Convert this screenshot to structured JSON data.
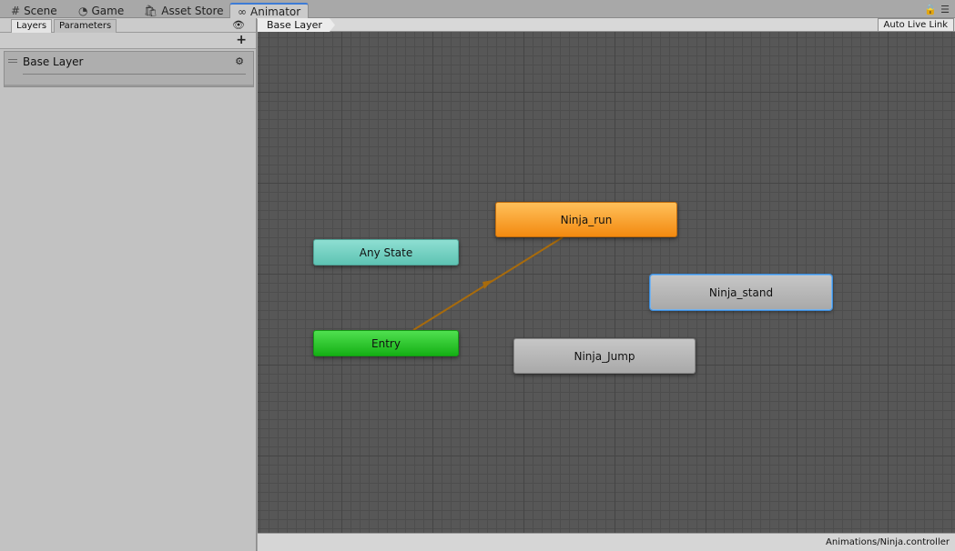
{
  "tabs": [
    {
      "label": "Scene",
      "icon": "hash-icon"
    },
    {
      "label": "Game",
      "icon": "pacman-icon"
    },
    {
      "label": "Asset Store",
      "icon": "store-bag-icon"
    },
    {
      "label": "Animator",
      "icon": "animator-icon"
    }
  ],
  "left_panel": {
    "tabs": [
      "Layers",
      "Parameters"
    ],
    "layer": {
      "name": "Base Layer"
    }
  },
  "graph": {
    "breadcrumb": "Base Layer",
    "auto_live_link": "Auto Live Link",
    "states": {
      "any_state": "Any State",
      "entry": "Entry",
      "ninja_run": "Ninja_run",
      "ninja_stand": "Ninja_stand",
      "ninja_jump": "Ninja_Jump"
    }
  },
  "status": {
    "path": "Animations/Ninja.controller"
  },
  "colors": {
    "accent": "#3d7bd6",
    "default_state": "#f38a10",
    "entry": "#15b015",
    "any_state": "#5ec3b3",
    "transition": "#a86b0c"
  }
}
